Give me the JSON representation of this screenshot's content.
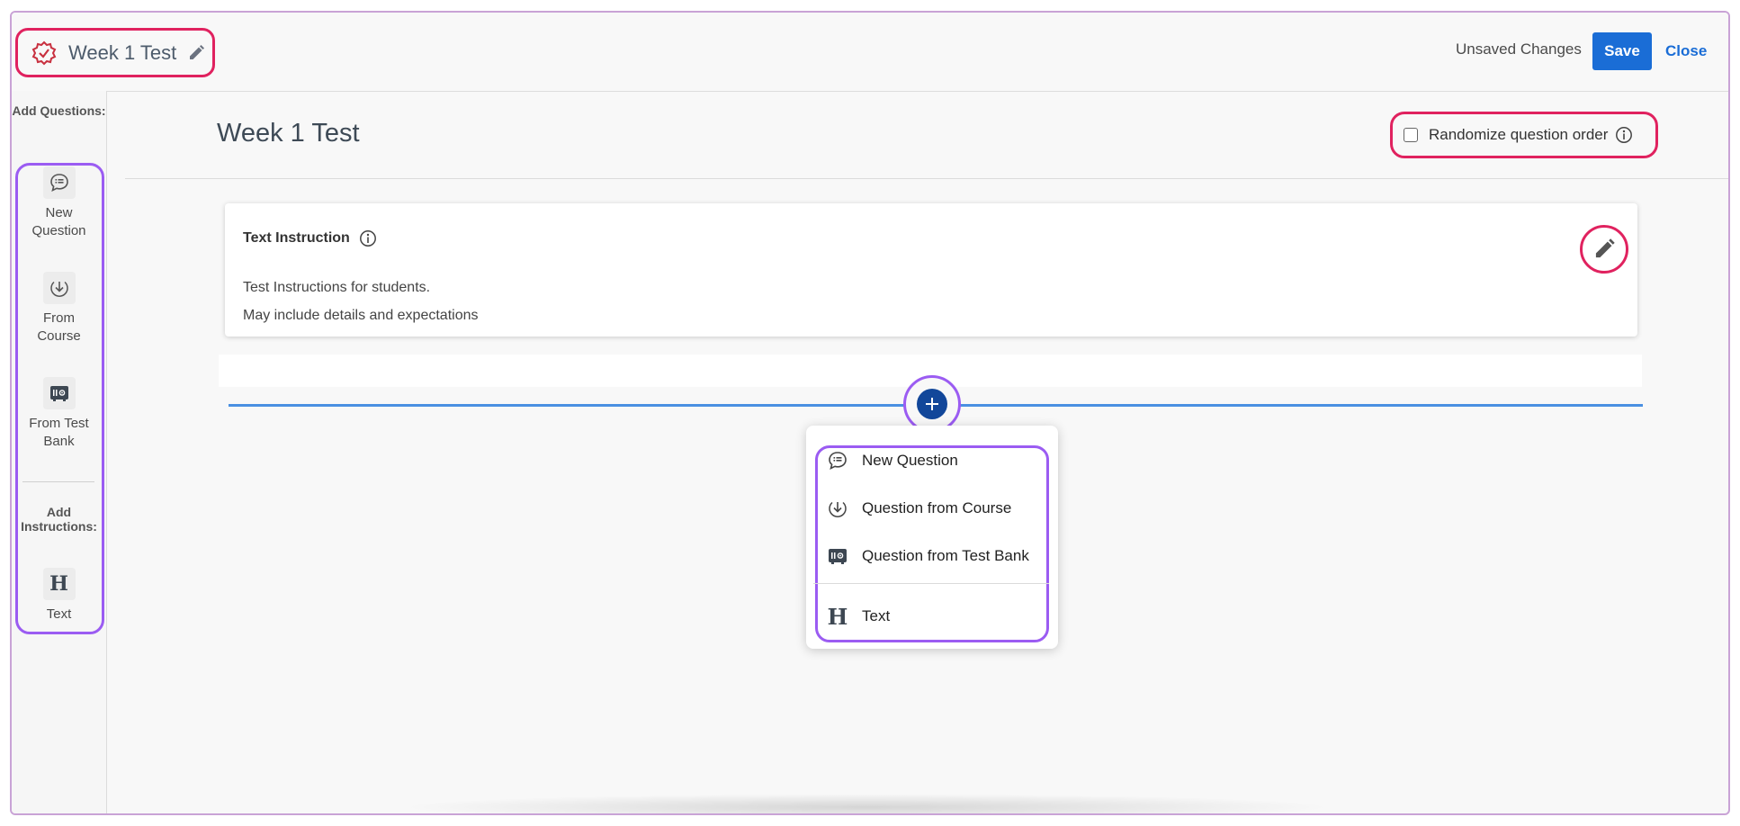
{
  "header": {
    "title": "Week 1 Test",
    "status": "Unsaved Changes",
    "save_label": "Save",
    "close_label": "Close"
  },
  "sidebar": {
    "add_questions_heading": "Add Questions:",
    "question_items": [
      {
        "label": "New Question",
        "icon": "new-question-icon"
      },
      {
        "label": "From Course",
        "icon": "course-download-icon"
      },
      {
        "label": "From Test Bank",
        "icon": "test-bank-icon"
      }
    ],
    "add_instructions_heading": "Add Instructions:",
    "instruction_items": [
      {
        "label": "Text",
        "icon": "heading-text-icon"
      }
    ]
  },
  "main": {
    "test_title": "Week 1 Test",
    "randomize_label": "Randomize question order",
    "randomize_checked": false
  },
  "instruction_card": {
    "title": "Text Instruction",
    "lines": [
      "Test Instructions for students.",
      "May include details and expectations"
    ]
  },
  "add_menu": {
    "items": [
      {
        "label": "New Question",
        "icon": "new-question-icon"
      },
      {
        "label": "Question from Course",
        "icon": "course-download-icon"
      },
      {
        "label": "Question from Test Bank",
        "icon": "test-bank-icon"
      },
      {
        "label": "Text",
        "icon": "heading-text-icon"
      }
    ]
  },
  "colors": {
    "primary": "#1a6dd6",
    "plus_button": "#12479a",
    "highlight_pink": "#e0225f",
    "highlight_purple": "#9b5cf2",
    "insert_line": "#4a90e2",
    "badge_red": "#c8303f"
  }
}
